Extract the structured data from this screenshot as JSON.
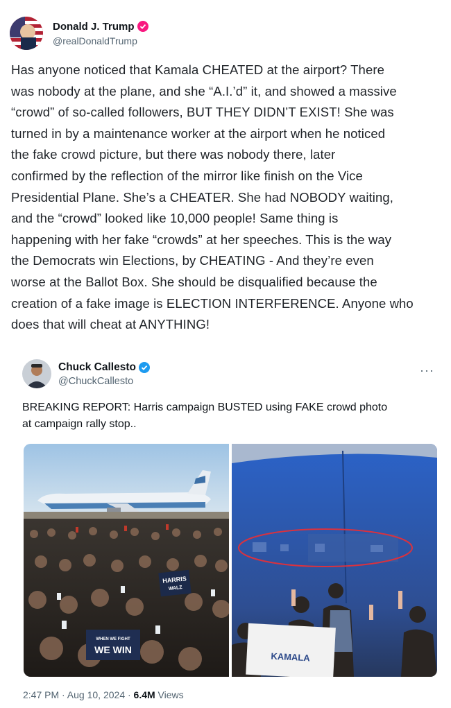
{
  "author": {
    "name": "Donald J. Trump",
    "handle": "@realDonaldTrump",
    "verified_color": "#f91880"
  },
  "tweet": {
    "lines": [
      "Has anyone noticed that Kamala CHEATED at the airport? There",
      "was nobody at the plane, and she “A.I.’d” it, and showed a massive",
      "“crowd” of so-called followers, BUT THEY DIDN’T EXIST! She was",
      "turned in by a maintenance worker at the airport when he noticed",
      "the fake crowd picture, but there was nobody there, later",
      "confirmed by the reflection of the mirror like finish on the Vice",
      "Presidential Plane. She’s a CHEATER. She had NOBODY waiting,",
      "and the “crowd” looked like 10,000 people! Same thing is",
      "happening with her fake “crowds” at her speeches. This is the way",
      "the Democrats win Elections, by CHEATING - And they’re even",
      "worse at the Ballot Box. She should be disqualified because the",
      "creation of a fake image is ELECTION INTERFERENCE. Anyone who",
      "does that will cheat at ANYTHING!"
    ]
  },
  "quote": {
    "name": "Chuck Callesto",
    "handle": "@ChuckCallesto",
    "verified_color": "#1d9bf0",
    "more": "···",
    "lines": [
      "BREAKING REPORT: Harris campaign BUSTED using FAKE crowd photo",
      "at campaign rally stop.."
    ],
    "media": {
      "left_signs": {
        "sign1": "HARRIS",
        "sign1b": "WALZ",
        "sign2a": "WHEN WE FIGHT",
        "sign2b": "WE WIN"
      },
      "right_sign": "KAMALA"
    }
  },
  "meta": {
    "time": "2:47 PM · Aug 10, 2024 · ",
    "views": "6.4M",
    "views_label": " Views"
  }
}
